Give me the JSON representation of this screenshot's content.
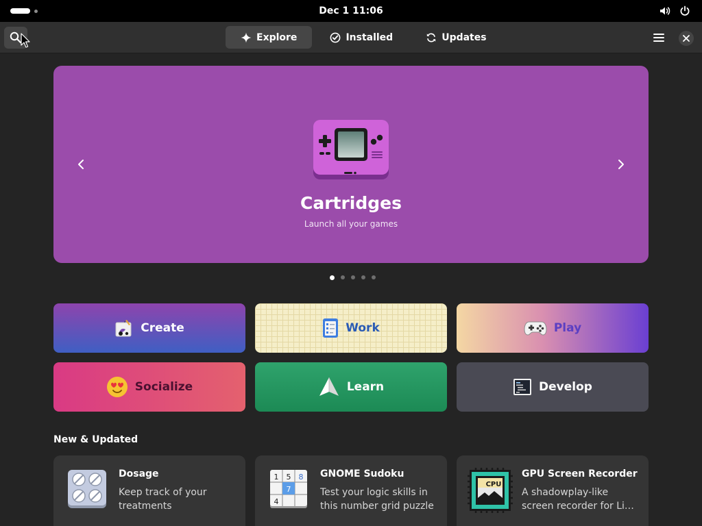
{
  "system_bar": {
    "clock": "Dec 1  11:06",
    "indicators": [
      "volume-icon",
      "power-icon"
    ]
  },
  "header": {
    "tabs": [
      {
        "label": "Explore",
        "icon": "sparkle-icon",
        "active": true
      },
      {
        "label": "Installed",
        "icon": "check-circle-icon",
        "active": false
      },
      {
        "label": "Updates",
        "icon": "refresh-icon",
        "active": false
      }
    ]
  },
  "featured": {
    "title": "Cartridges",
    "subtitle": "Launch all your games",
    "background": "#9b4cab",
    "page_count": 5,
    "current_page": 1
  },
  "categories": [
    {
      "label": "Create",
      "icon": "create-icon"
    },
    {
      "label": "Work",
      "icon": "work-icon"
    },
    {
      "label": "Play",
      "icon": "gamepad-icon"
    },
    {
      "label": "Socialize",
      "icon": "smiley-icon"
    },
    {
      "label": "Learn",
      "icon": "paper-plane-icon"
    },
    {
      "label": "Develop",
      "icon": "terminal-icon"
    }
  ],
  "new_updated": {
    "title": "New & Updated",
    "apps": [
      {
        "name": "Dosage",
        "description": "Keep track of your treatments",
        "icon": "pills-icon"
      },
      {
        "name": "GNOME Sudoku",
        "description": "Test your logic skills in this number grid puzzle",
        "icon": "sudoku-icon"
      },
      {
        "name": "GPU Screen Recorder",
        "description": "A shadowplay-like screen recorder for Li…",
        "icon": "cpu-recorder-icon"
      }
    ]
  }
}
